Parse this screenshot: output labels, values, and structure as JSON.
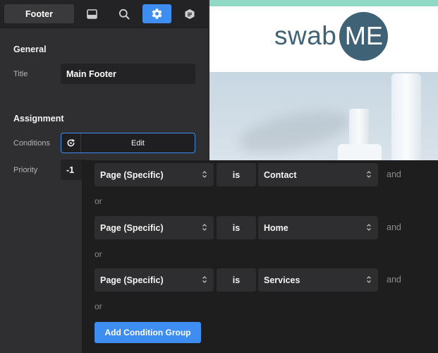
{
  "tabs": {
    "active_label": "Footer",
    "icons": [
      "layout-icon",
      "search-icon",
      "gear-icon",
      "form-icon"
    ]
  },
  "general": {
    "heading": "General",
    "title_label": "Title",
    "title_value": "Main Footer"
  },
  "assignment": {
    "heading": "Assignment",
    "conditions_label": "Conditions",
    "conditions_button": "Edit",
    "priority_label": "Priority",
    "priority_value": "-1"
  },
  "preview": {
    "logo_text": "swab",
    "logo_badge": "ME"
  },
  "conditions": {
    "groups": [
      {
        "type": "Page (Specific)",
        "operator": "is",
        "value": "Contact",
        "and": "and"
      },
      {
        "type": "Page (Specific)",
        "operator": "is",
        "value": "Home",
        "and": "and"
      },
      {
        "type": "Page (Specific)",
        "operator": "is",
        "value": "Services",
        "and": "and"
      }
    ],
    "or_label": "or",
    "add_group_button": "Add Condition Group"
  },
  "colors": {
    "accent": "#3d8ef0",
    "panel_bg": "#2f2f31",
    "popup_bg": "#1e1e1f",
    "logo": "#3f6276",
    "top_stripe": "#8fd9c6"
  }
}
